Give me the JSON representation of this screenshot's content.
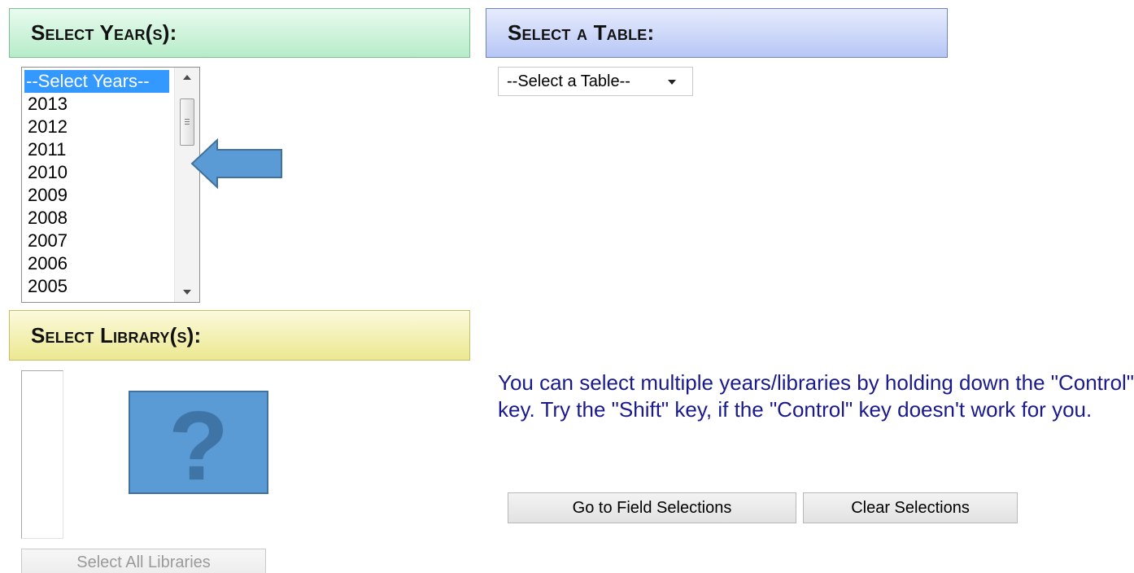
{
  "headers": {
    "year": "Select Year(s):",
    "table": "Select a Table:",
    "library": "Select Library(s):"
  },
  "years_list": {
    "options": [
      "--Select Years--",
      "2013",
      "2012",
      "2011",
      "2010",
      "2009",
      "2008",
      "2007",
      "2006",
      "2005"
    ],
    "selected": "--Select Years--"
  },
  "table_select": {
    "value": "--Select a Table--"
  },
  "help_text": "You can select multiple years/libraries by holding down the \"Control\" key. Try the \"Shift\" key, if the \"Control\" key doesn't work for you.",
  "buttons": {
    "go_to_fields": "Go to Field Selections",
    "clear": "Clear Selections",
    "select_all_libraries": "Select All Libraries"
  },
  "annotations": {
    "question_mark": "?",
    "arrow_color": "#5b9bd5",
    "box_color": "#5b9bd5"
  },
  "colors": {
    "header_year": "#b6ecc8",
    "header_table": "#b7c6f5",
    "header_library": "#ece890",
    "help_text": "#1a1a8c",
    "selected_option": "#3399ff"
  }
}
